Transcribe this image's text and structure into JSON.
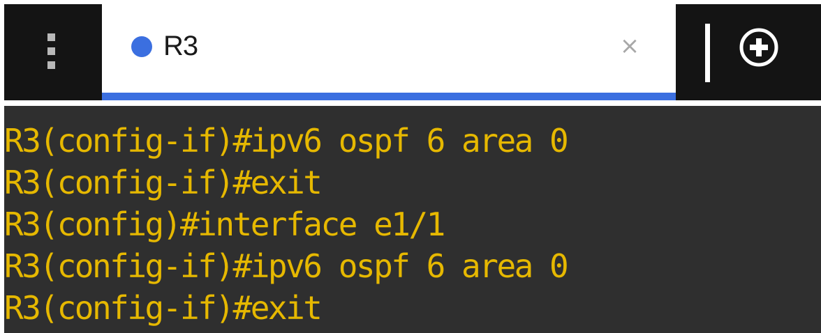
{
  "tabbar": {
    "menu_icon": "vertical-dots-icon",
    "tab": {
      "label": "R3",
      "status_color": "#3b6fe0",
      "close_label": "×",
      "indicator_color": "#3b6fe0",
      "active": true
    },
    "add_icon": "plus-circle-icon"
  },
  "terminal": {
    "text_color": "#e6b800",
    "background": "#2f2f2f",
    "lines": [
      "R3(config-if)#ipv6 ospf 6 area 0",
      "R3(config-if)#exit",
      "R3(config)#interface e1/1",
      "R3(config-if)#ipv6 ospf 6 area 0",
      "R3(config-if)#exit"
    ]
  }
}
